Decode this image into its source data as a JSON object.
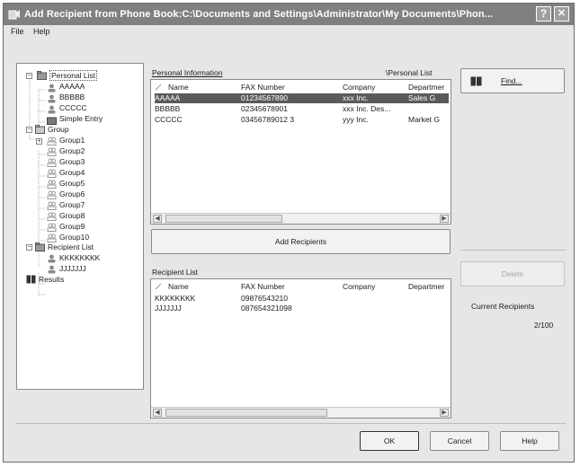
{
  "window": {
    "title": "Add Recipient from Phone Book:C:\\Documents and Settings\\Administrator\\My Documents\\Phon...",
    "help_glyph": "?",
    "close_glyph": "✕"
  },
  "menu": {
    "file": "File",
    "help": "Help"
  },
  "tree": {
    "personal_list": "Personal List",
    "persons": [
      "AAAAA",
      "BBBBB",
      "CCCCC"
    ],
    "simple_entry": "Simple Entry",
    "group": "Group",
    "groups": [
      "Group1",
      "Group2",
      "Group3",
      "Group4",
      "Group5",
      "Group6",
      "Group7",
      "Group8",
      "Group9",
      "Group10"
    ],
    "recipient_list": "Recipient List",
    "recipients": [
      "KKKKKKKK",
      "JJJJJJJ"
    ],
    "results": "Results"
  },
  "personal_info": {
    "label": "Personal Information",
    "path": "\\Personal List",
    "columns": [
      "Name",
      "FAX Number",
      "Company",
      "Departmer"
    ],
    "rows": [
      [
        "AAAAA",
        "01234567890",
        "xxx Inc.",
        "Sales G"
      ],
      [
        "BBBBB",
        "02345678901",
        "xxx Inc. Des...",
        ""
      ],
      [
        "CCCCC",
        "03456789012 3",
        "yyy Inc.",
        "Market G"
      ]
    ]
  },
  "buttons": {
    "find": "Find...",
    "add_recipients": "Add Recipients",
    "delete": "Delete",
    "ok": "OK",
    "cancel": "Cancel",
    "help": "Help"
  },
  "recipient_list": {
    "label": "Recipient List",
    "columns": [
      "Name",
      "FAX Number",
      "Company",
      "Departmer"
    ],
    "rows": [
      [
        "KKKKKKKK",
        "09876543210",
        "",
        ""
      ],
      [
        "JJJJJJJ",
        "087654321098",
        "",
        ""
      ]
    ]
  },
  "current_recipients": {
    "label": "Current Recipients",
    "value": "2/100"
  },
  "colors": {
    "title_bar": "#808080",
    "selection": "#5a5a5a",
    "dialog": "#e6e6e6"
  }
}
